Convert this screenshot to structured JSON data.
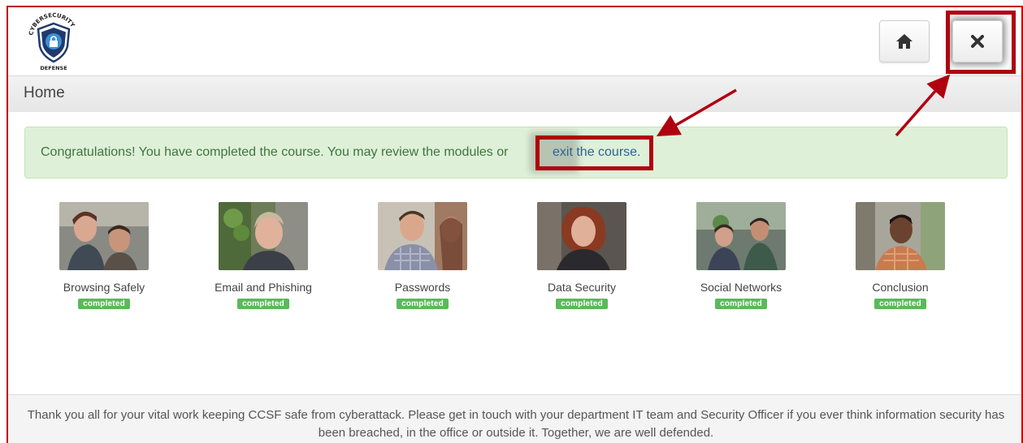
{
  "colors": {
    "highlight": "#b00010",
    "alert_bg": "#dff0d8",
    "alert_text": "#3c763d",
    "link": "#2a6496",
    "badge": "#5cb85c"
  },
  "header": {
    "logo_icon": "cybersecurity-defense-shield-logo",
    "logo_top_text": "CYBERSECURITY",
    "logo_bottom_text": "DEFENSE",
    "home_icon": "home-icon",
    "close_icon": "close-icon"
  },
  "page": {
    "title": "Home"
  },
  "alert": {
    "message": "Congratulations! You have completed the course. You may review the modules or",
    "link_text": "exit the course."
  },
  "modules": [
    {
      "title": "Browsing Safely",
      "status": "completed"
    },
    {
      "title": "Email and Phishing",
      "status": "completed"
    },
    {
      "title": "Passwords",
      "status": "completed"
    },
    {
      "title": "Data Security",
      "status": "completed"
    },
    {
      "title": "Social Networks",
      "status": "completed"
    },
    {
      "title": "Conclusion",
      "status": "completed"
    }
  ],
  "footer": {
    "text": "Thank you all for your vital work keeping CCSF safe from cyberattack. Please get in touch with your department IT team and Security Officer if you ever think information security has been breached, in the office or outside it. Together, we are well defended."
  }
}
